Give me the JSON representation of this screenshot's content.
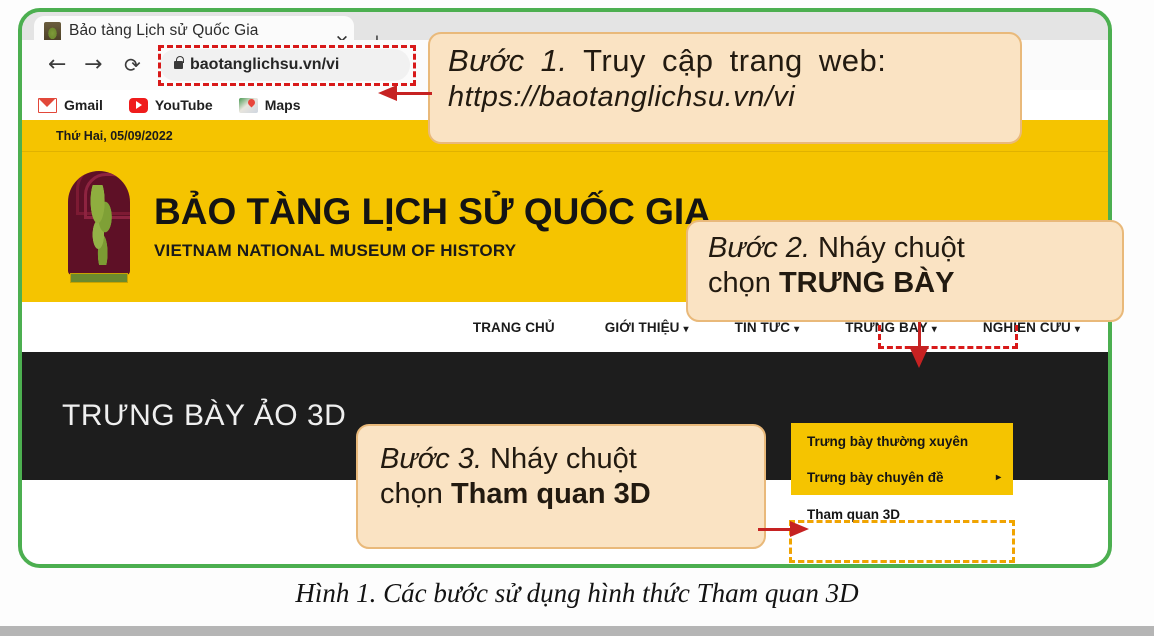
{
  "browser": {
    "tab": {
      "title": "Bảo tàng Lịch sử Quốc Gia",
      "favicon": "museum-favicon",
      "close_label": "✕",
      "new_tab_label": "+"
    },
    "toolbar": {
      "back": "←",
      "forward": "→",
      "reload": "⟳",
      "lock": "lock-icon",
      "url": "baotanglichsu.vn/vi"
    },
    "bookmarks": [
      {
        "label": "Gmail",
        "icon": "gmail-icon"
      },
      {
        "label": "YouTube",
        "icon": "youtube-icon"
      },
      {
        "label": "Maps",
        "icon": "maps-icon"
      }
    ]
  },
  "site": {
    "date": "Thứ Hai, 05/09/2022",
    "title": "BẢO TÀNG LỊCH SỬ QUỐC GIA",
    "subtitle": "VIETNAM NATIONAL MUSEUM OF HISTORY",
    "nav": [
      {
        "label": "TRANG CHỦ",
        "caret": ""
      },
      {
        "label": "GIỚI THIỆU",
        "caret": "▾"
      },
      {
        "label": "TIN TỨC",
        "caret": "▾"
      },
      {
        "label": "TRƯNG BÀY",
        "caret": "▾"
      },
      {
        "label": "NGHIÊN CỨU",
        "caret": "▾"
      }
    ],
    "dropdown": [
      {
        "label": "Trưng bày thường xuyên",
        "arrow": "",
        "selected": false
      },
      {
        "label": "Trưng bày chuyên đề",
        "arrow": "▸",
        "selected": false
      },
      {
        "label": "Tham quan 3D",
        "arrow": "",
        "selected": true
      }
    ],
    "band_title": "TRƯNG BÀY ẢO 3D"
  },
  "callouts": {
    "step1": {
      "step": "Bước 1.",
      "line1_rest": " Truy cập trang web:",
      "line2": "https://baotanglichsu.vn/vi"
    },
    "step2": {
      "step": "Bước 2.",
      "line1_rest": " Nháy chuột",
      "line2_prefix": "chọn ",
      "line2_bold": "TRƯNG BÀY"
    },
    "step3": {
      "step": "Bước 3.",
      "line1_rest": " Nháy chuột",
      "line2_prefix": "chọn ",
      "line2_bold": "Tham quan 3D"
    }
  },
  "caption": "Hình 1. Các bước sử dụng hình thức Tham quan 3D",
  "colors": {
    "frame_green": "#4caf50",
    "site_yellow": "#f5c400",
    "callout_bg": "#fae3c3",
    "callout_border": "#e9b97a",
    "arrow_red": "#c62222",
    "highlight_red": "#d81919",
    "band_black": "#1d1d1d"
  }
}
